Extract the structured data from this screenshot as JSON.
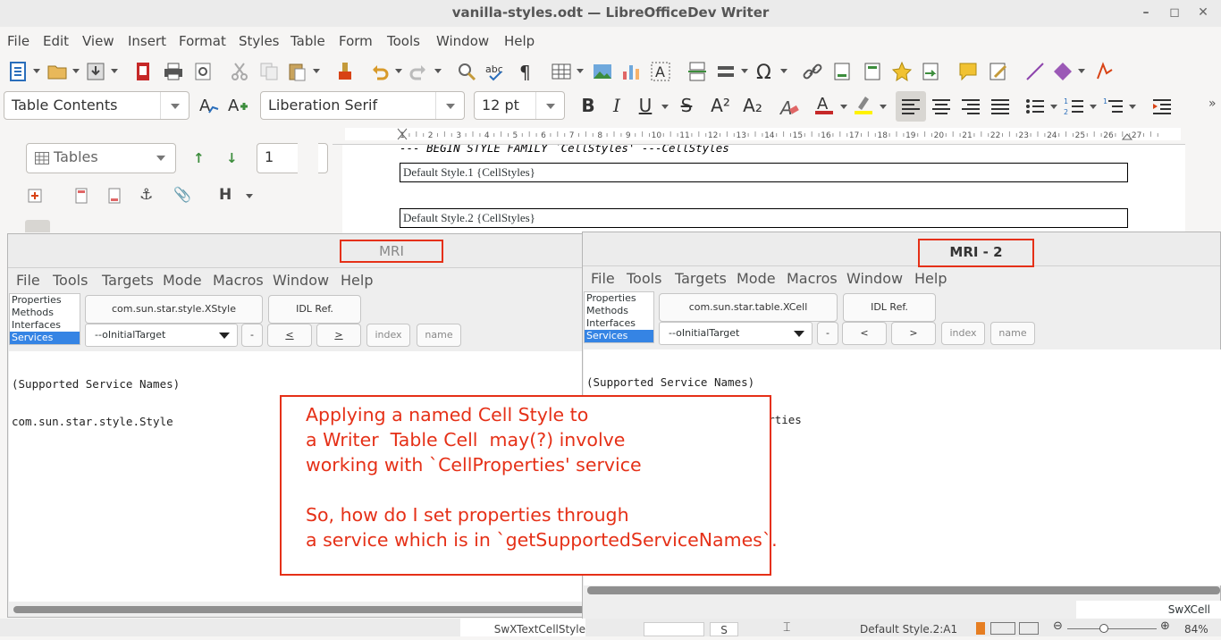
{
  "window": {
    "title": "vanilla-styles.odt — LibreOfficeDev Writer",
    "minimize": "–",
    "maximize": "◻",
    "close": "✕"
  },
  "menu": [
    "File",
    "Edit",
    "View",
    "Insert",
    "Format",
    "Styles",
    "Table",
    "Form",
    "Tools",
    "Window",
    "Help"
  ],
  "toolbar": {
    "paragraph_style": "Table Contents",
    "font_name": "Liberation Serif",
    "font_size": "12 pt",
    "bold": "B",
    "italic": "I",
    "underline": "U",
    "strike": "S",
    "superscript": "A²",
    "subscript": "A₂",
    "icons": [
      "new-document-icon",
      "open-icon",
      "save-icon",
      "export-pdf-icon",
      "print-icon",
      "print-preview-icon",
      "cut-icon",
      "copy-icon",
      "paste-icon",
      "clone-formatting-icon",
      "undo-icon",
      "redo-icon",
      "find-replace-icon",
      "spelling-icon",
      "formatting-marks-icon",
      "insert-table-icon",
      "insert-image-icon",
      "insert-chart-icon",
      "insert-textbox-icon",
      "insert-page-break-icon",
      "insert-field-icon",
      "special-character-icon",
      "hyperlink-icon",
      "footnote-icon",
      "endnote-icon",
      "bookmark-icon",
      "cross-reference-icon",
      "comment-icon",
      "track-changes-icon",
      "line-icon",
      "shapes-icon",
      "draw-functions-icon"
    ]
  },
  "navigator": {
    "category": "Tables",
    "page_number": "1",
    "up_icon": "up-arrow-icon",
    "down_icon": "down-arrow-icon"
  },
  "ruler": {
    "ticks": [
      "1",
      "2",
      "3",
      "4",
      "5",
      "6",
      "7",
      "8",
      "9",
      "10",
      "11",
      "12",
      "13",
      "14",
      "15",
      "16",
      "17",
      "18",
      "19",
      "20",
      "21",
      "22",
      "23",
      "24",
      "25",
      "26",
      "27"
    ]
  },
  "document": {
    "heading": "--- BEGIN STYLE FAMILY `CellStyles' ---CellStyles",
    "cells": [
      "Default Style.1 {CellStyles}",
      "Default Style.2 {CellStyles}"
    ]
  },
  "mri1": {
    "title": "MRI",
    "menu": [
      "File",
      "Tools",
      "Targets",
      "Mode",
      "Macros",
      "Window",
      "Help"
    ],
    "categories": [
      "Properties",
      "Methods",
      "Interfaces",
      "Services"
    ],
    "selected_category": "Services",
    "interface_name": "com.sun.star.style.XStyle",
    "idl_ref": "IDL Ref.",
    "target": "--oInitialTarget",
    "minus": "-",
    "prev": "<",
    "next": ">",
    "index_placeholder": "index",
    "name_placeholder": "name",
    "output": [
      "(Supported Service Names)",
      "com.sun.star.style.Style"
    ]
  },
  "mri2": {
    "title": "MRI - 2",
    "menu": [
      "File",
      "Tools",
      "Targets",
      "Mode",
      "Macros",
      "Window",
      "Help"
    ],
    "categories": [
      "Properties",
      "Methods",
      "Interfaces",
      "Services"
    ],
    "selected_category": "Services",
    "interface_name": "com.sun.star.table.XCell",
    "idl_ref": "IDL Ref.",
    "target": "--oInitialTarget",
    "minus": "-",
    "prev": "<",
    "next": ">",
    "index_placeholder": "index",
    "name_placeholder": "name",
    "output": [
      "(Supported Service Names)",
      "com.sun.star.text.CellProperties"
    ],
    "status": "SwXCell"
  },
  "annotation": {
    "lines": [
      "Applying a named Cell Style to",
      "a Writer  Table Cell  may(?) involve",
      "working with `CellProperties' service",
      "",
      "So, how do I set properties through",
      "a service which is in `getSupportedServiceNames`."
    ]
  },
  "statusbar": {
    "left": "SwXTextCellStyle",
    "mode": "S",
    "cell": "Default Style.2:A1",
    "zoom": "84%"
  },
  "colors": {
    "accent": "#3584e4",
    "annotation": "#e53017"
  }
}
